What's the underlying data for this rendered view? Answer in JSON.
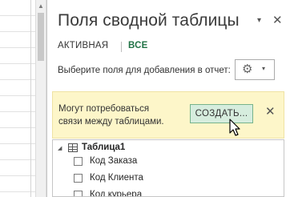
{
  "pane": {
    "title": "Поля сводной таблицы",
    "dropdown_icon": "▾",
    "close_icon": "✕",
    "tabs": [
      {
        "label": "АКТИВНАЯ",
        "selected": false
      },
      {
        "label": "ВСЕ",
        "selected": true
      }
    ],
    "choose_label": "Выберите поля для добавления в отчет:",
    "settings": {
      "icon": "gear-icon",
      "caret": "▾"
    }
  },
  "warning": {
    "text_line1": "Могут потребоваться",
    "text_line2": "связи между таблицами.",
    "create_label": "СОЗДАТЬ...",
    "close_icon": "✕"
  },
  "fields": {
    "table_name": "Таблица1",
    "items": [
      {
        "label": "Код Заказа",
        "checked": false
      },
      {
        "label": "Код Клиента",
        "checked": false
      },
      {
        "label": "Код курьера",
        "checked": false
      }
    ]
  },
  "colors": {
    "accent_green": "#217346",
    "warning_bg": "#fdf6c9",
    "button_bg": "#d6edde"
  }
}
